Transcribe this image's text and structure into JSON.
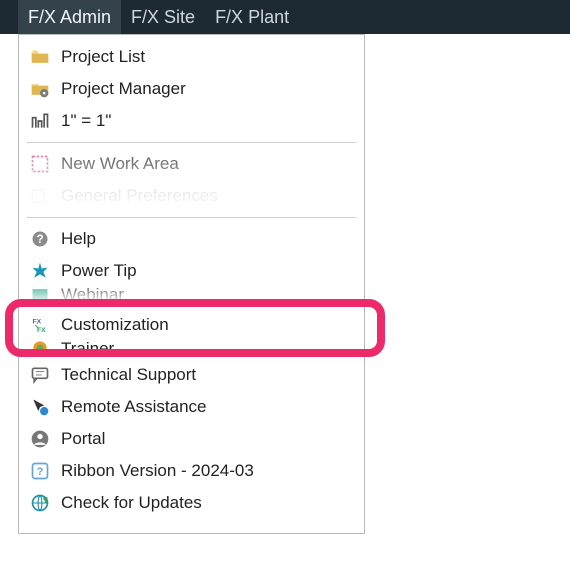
{
  "menubar": {
    "items": [
      {
        "label": "F/X Admin",
        "active": true
      },
      {
        "label": "F/X Site",
        "active": false
      },
      {
        "label": "F/X Plant",
        "active": false
      }
    ]
  },
  "menu": {
    "project_list": "Project List",
    "project_manager": "Project Manager",
    "scale": "1\" = 1\"",
    "new_work_area": "New Work Area",
    "general_preferences": "General Preferences",
    "help": "Help",
    "power_tip": "Power Tip",
    "webinar": "Webinar",
    "customization": "Customization",
    "trainer": "Trainer",
    "technical_support": "Technical Support",
    "remote_assistance": "Remote Assistance",
    "portal": "Portal",
    "ribbon_version": "Ribbon Version - 2024-03",
    "check_for_updates": "Check for Updates"
  },
  "highlight": "customization"
}
